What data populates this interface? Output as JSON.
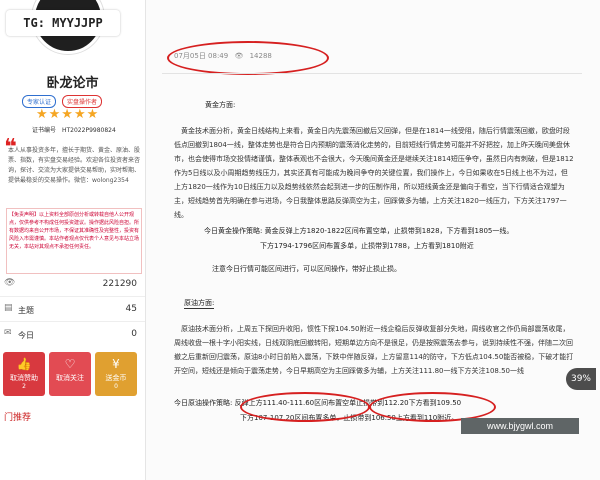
{
  "overlay_label": "TG: MYYJJPP",
  "zoom_badge": "39%",
  "watermark": "www.bjygwl.com",
  "sidebar": {
    "name": "卧龙论市",
    "badges": [
      "专家认证",
      "实盘操作者"
    ],
    "stars": "★★★★★",
    "cert": "证书编号　HT2022P9980824",
    "quote_mark": "❝",
    "intro": "本人从事投资多年，擅长于期货、黄金、原油、股票、指数，有实盘交易经验。欢迎各位投资者来咨询，探讨、交流为大家提供交易帮助，实时帮期、提供最稳妥的交易操作。微信：wolong2354",
    "disclaimer": "【免责声明】以上资料全部原创分析或转载自他人公开观点，仅供参考不构成任何投资建议。操作据此风险自担。所有数据均来自公开市场，不保证其准确性及完整性，投资有风险入市需谨慎。本站作者观点仅代表个人意见与本站立场无关，本站对其观点不承担任何责任。",
    "stats": [
      {
        "icon": "👁",
        "label": "",
        "value": "221290"
      },
      {
        "icon": "▤",
        "label": "主题",
        "value": "45"
      },
      {
        "icon": "✉",
        "label": "今日",
        "value": "0"
      }
    ],
    "actions": [
      {
        "glyph": "👍",
        "label": "取消赞助",
        "count": "2"
      },
      {
        "glyph": "♡",
        "label": "取消关注",
        "count": ""
      },
      {
        "glyph": "¥",
        "label": "送金币",
        "count": "0"
      }
    ],
    "recommend": "门推荐"
  },
  "article": {
    "date": "07月05日 08:49",
    "views_icon": "👁",
    "views": "14288",
    "gold_heading": "黄金方面:",
    "gold_para": "黄金技术面分析，黄金日线结构上来看，黄金日内先震荡回撤后又回弹，但是在1814一线受阻，随后行情震荡回撤，欧盘时段低点回撤到1804一线，整体走势也是符合日内预期的震荡消化走势的，目前短线行情走势可能并不好把控，加上昨天晚间美盘休市，也会使得市场交投情绪谨慎，整体表观也不会很大，今天晚间黄金还是继续关注1814短压争夺，虽然日内有刺破，但是1812作为5日线以及小周期趋势线压力，其实还真有可能成为晚间争夺的关键位置，我们操作上，今日如果收在5日线上也不为过，但上方1820一线作为10日线压力以及趋势线依然会起到进一步的压制作用，所以短线黄金还是偏向于看空，当下行情适合观望为主，短线趋势首先明确在参与进场，今日我整体思路反弹高空为主，回踩做多为辅，上方关注1820一线压力，下方关注1797一线。",
    "gold_ops_title": "今日黄金操作策略:",
    "gold_ops_1": "黄金反弹上方1820-1822区间布置空单，止损带到1828，下方看到1805一线。",
    "gold_ops_2": "下方1794-1796区间布置多单，止损带到1788，上方看到1810附近",
    "gold_note": "注意今日行情可能区间进行，可以区间操作，带好止损止损。",
    "oil_heading": "原油方面:",
    "oil_para": "原油技术面分析，上周五下探回升收阳，惯性下探104.50附近一线企稳后反弹收复部分失地，周线收官之作仍局部震荡收尾，周线收盘一根十字小阳实线，日线双阴底回撤转阳，短期单边方向不是很足，仍是按照震荡去参与，说到持续性不强，伴随二次回撤之后重新回归震荡，原油8小时日前陷入震荡，下跌中伴随反弹，上方留意114的防守，下方低点104.50能否被稳，下破才能打开空间，短线还是倾向于震荡走势，今日早期高空为主回踩做多为辅，上方关注111.80一线下方关注108.50一线",
    "oil_ops_title": "今日原油操作策略:",
    "oil_ops_1a": "反弹上方111.40-111.60区间",
    "oil_ops_1b": "布置空单止损带到112.20下方看到109.50",
    "oil_ops_2": "下方107-107.20区间布置多单，止损带到106.50上方看到110附近。"
  }
}
